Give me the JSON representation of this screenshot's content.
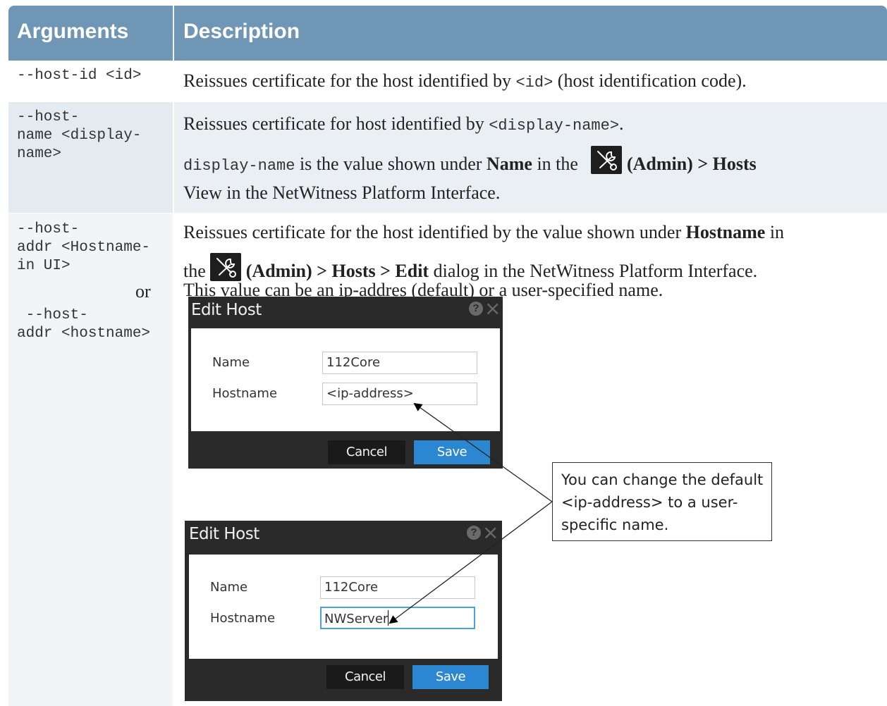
{
  "header": {
    "col_arguments": "Arguments",
    "col_description": "Description"
  },
  "rows": [
    {
      "arg": "--host-id <id>",
      "desc_prefix": "Reissues certificate for the host identified by ",
      "desc_code": "<id>",
      "desc_suffix": " (host identification code)."
    },
    {
      "arg": "--host-\nname <display-\nname>",
      "desc_line1_prefix": "Reissues certificate for host identified by ",
      "desc_line1_code": "<display-name>",
      "desc_line1_suffix": ".",
      "desc_line2_code": "display-name",
      "desc_line2_a": " is the value shown under ",
      "desc_line2_bold1": "Name",
      "desc_line2_b": " in the ",
      "desc_line2_bold2": " (Admin) > Hosts",
      "desc_line3": "View in the NetWitness Platform Interface."
    },
    {
      "arg_a": "--host-\naddr <Hostname-\nin UI>",
      "arg_or": "or",
      "arg_b": " --host-\naddr <hostname>",
      "desc_line1_a": "Reissues certificate for the host identified by the value shown under ",
      "desc_line1_bold": "Hostname",
      "desc_line1_b": " in",
      "desc_line2_a": "the ",
      "desc_line2_bold": " (Admin) > Hosts > Edit",
      "desc_line2_b": " dialog in the NetWitness Platform Interface.",
      "desc_line3": "This value can be an ip-addres (default) or a user-specified name."
    }
  ],
  "dialogs": [
    {
      "title": "Edit Host",
      "name_label": "Name",
      "name_value": "112Core",
      "hostname_label": "Hostname",
      "hostname_value": "<ip-address>",
      "cancel": "Cancel",
      "save": "Save"
    },
    {
      "title": "Edit Host",
      "name_label": "Name",
      "name_value": "112Core",
      "hostname_label": "Hostname",
      "hostname_value": "NWServer",
      "cancel": "Cancel",
      "save": "Save"
    }
  ],
  "callout": {
    "text": "You can change the default <ip-address> to a user-specific name."
  },
  "icons": {
    "admin": "admin-tools-icon",
    "help": "help-icon",
    "close": "close-icon"
  },
  "colors": {
    "header_bg": "#6f97b5",
    "row_alt_bg": "#e9eff3",
    "save_button": "#2b87d1",
    "dialog_bg": "#2a2a2a"
  }
}
